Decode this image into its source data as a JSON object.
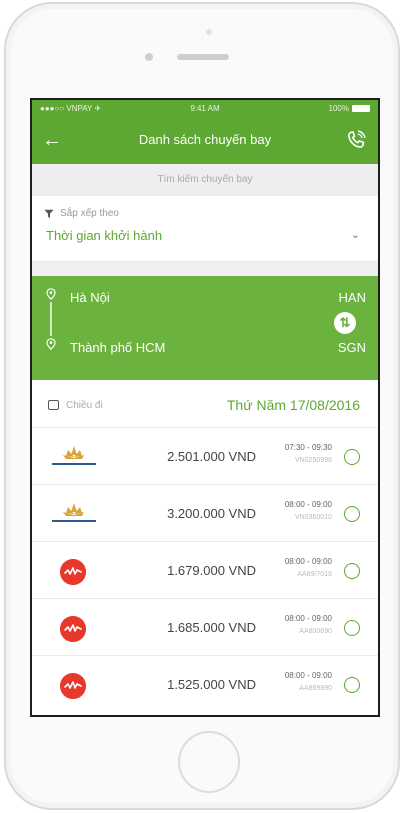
{
  "status_bar": {
    "carrier": "●●●○○ VNPAY ✈",
    "time": "9:41 AM",
    "battery": "100%"
  },
  "header": {
    "title": "Danh sách chuyến bay"
  },
  "search": {
    "label": "Tìm kiếm chuyến bay"
  },
  "sort": {
    "label": "Sắp xếp theo",
    "value": "Thời gian khởi hành"
  },
  "route": {
    "from_city": "Hà Nội",
    "from_code": "HAN",
    "to_city": "Thành phố HCM",
    "to_code": "SGN"
  },
  "trip": {
    "direction_label": "Chiều đi",
    "date": "Thứ Năm 17/08/2016"
  },
  "flights": [
    {
      "airline": "vietnam-airlines-logo",
      "price": "2.501.000 VND",
      "time": "07:30 - 09:30",
      "code": "VN0250996",
      "selected": false
    },
    {
      "airline": "vietnam-airlines-logo",
      "price": "3.200.000 VND",
      "time": "08:00 - 09:00",
      "code": "VN0360010",
      "selected": false
    },
    {
      "airline": "airasia-logo",
      "price": "1.679.000 VND",
      "time": "08:00 - 09:00",
      "code": "AA89/7016",
      "selected": false
    },
    {
      "airline": "airasia-logo",
      "price": "1.685.000 VND",
      "time": "08:00 - 09:00",
      "code": "AA800690",
      "selected": false
    },
    {
      "airline": "airasia-logo",
      "price": "1.525.000 VND",
      "time": "08:00 - 09:00",
      "code": "AA869890",
      "selected": false
    }
  ],
  "colors": {
    "accent": "#5da832",
    "route_bg": "#6cb23f",
    "airasia_red": "#e8372b",
    "va_gold": "#d9a43a",
    "va_blue": "#2d5c8a"
  }
}
